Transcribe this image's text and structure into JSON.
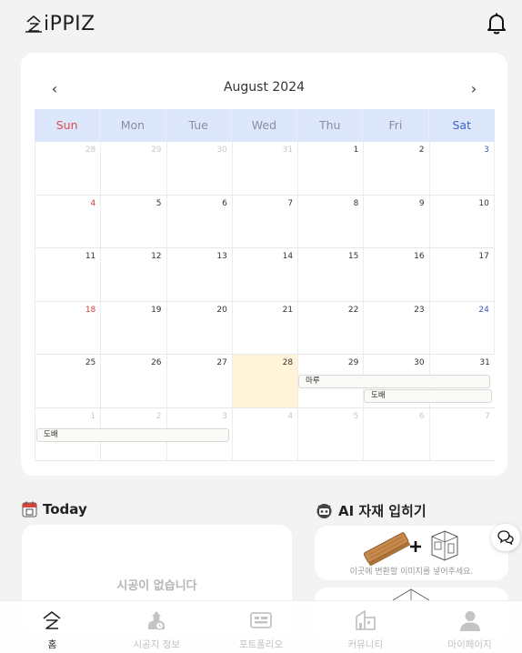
{
  "header": {
    "logo_text": "iPPIZ",
    "icons": [
      "logo-icon",
      "bell-icon"
    ]
  },
  "calendar": {
    "title": "August 2024",
    "prev_icon": "‹",
    "next_icon": "›",
    "weekdays": [
      "Sun",
      "Mon",
      "Tue",
      "Wed",
      "Thu",
      "Fri",
      "Sat"
    ],
    "weeks": [
      [
        "28",
        "29",
        "30",
        "31",
        "1",
        "2",
        "3"
      ],
      [
        "4",
        "5",
        "6",
        "7",
        "8",
        "9",
        "10"
      ],
      [
        "11",
        "12",
        "13",
        "14",
        "15",
        "16",
        "17"
      ],
      [
        "18",
        "19",
        "20",
        "21",
        "22",
        "23",
        "24"
      ],
      [
        "25",
        "26",
        "27",
        "28",
        "29",
        "30",
        "31"
      ],
      [
        "1",
        "2",
        "3",
        "4",
        "5",
        "6",
        "7"
      ]
    ],
    "today": "28",
    "events": [
      {
        "label": "마루"
      },
      {
        "label": "도배"
      },
      {
        "label": "도배"
      }
    ]
  },
  "today_section": {
    "title": "Today",
    "empty_text": "시공이 없습니다"
  },
  "ai_section": {
    "title": "AI 자재 입히기",
    "hint": "이곳에 변환할 이미지를 넣어주세요."
  },
  "bottom_nav": [
    {
      "label": "홈",
      "icon": "home-icon"
    },
    {
      "label": "시공지 정보",
      "icon": "site-info-icon"
    },
    {
      "label": "포트폴리오",
      "icon": "portfolio-icon"
    },
    {
      "label": "커뮤니티",
      "icon": "community-icon"
    },
    {
      "label": "마이페이지",
      "icon": "profile-icon"
    }
  ],
  "colors": {
    "today_bg": "#fff4d7",
    "weekday_header_bg": "#dde7fb",
    "sunday": "#d23b3b",
    "saturday": "#3c5fc4"
  }
}
